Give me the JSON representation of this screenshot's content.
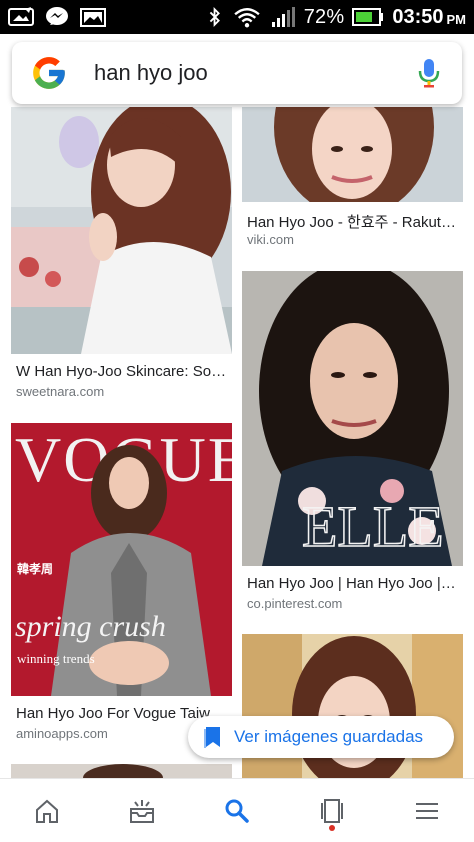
{
  "status_bar": {
    "battery_percent": "72%",
    "time": "03:50",
    "ampm": "PM",
    "icons": [
      "image-edit-icon",
      "messenger-icon",
      "gallery-icon",
      "bluetooth-icon",
      "wifi-icon",
      "signal-icon",
      "battery-icon"
    ]
  },
  "search": {
    "query": "han hyo joo",
    "logo": "google-g-logo",
    "mic": "mic-icon"
  },
  "results": [
    {
      "title": "W Han Hyo-Joo Skincare: Soor...",
      "source": "sweetnara.com"
    },
    {
      "title": "Han Hyo Joo - 한효주 - Rakuten...",
      "source": "viki.com"
    },
    {
      "title": "Han Hyo Joo For Vogue Taiwa...",
      "source": "aminoapps.com"
    },
    {
      "title": "Han Hyo Joo | Han Hyo Joo | P...",
      "source": "co.pinterest.com"
    }
  ],
  "magazine": {
    "vogue_masthead": "VOGUE",
    "vogue_chinese": "韓孝周",
    "vogue_headline": "spring crush",
    "vogue_sub": "winning trends",
    "elle_masthead": "ELLE"
  },
  "saved_button": {
    "label": "Ver imágenes guardadas",
    "icon": "bookmark-icon"
  },
  "bottom_nav": [
    "home-icon",
    "updates-icon",
    "search-icon",
    "tabs-icon",
    "menu-icon"
  ],
  "colors": {
    "accent_blue": "#1a73e8",
    "status_bg": "#000000",
    "battery_green": "#4cd137",
    "vogue_red": "#b3192d"
  }
}
